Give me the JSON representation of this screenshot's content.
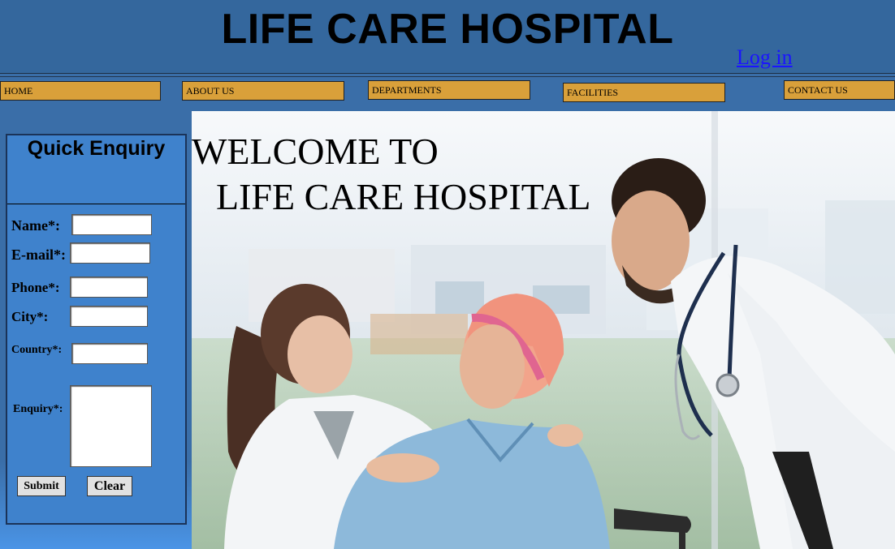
{
  "header": {
    "title": "LIFE CARE HOSPITAL",
    "login_label": "Log in"
  },
  "nav": {
    "items": [
      {
        "label": "HOME"
      },
      {
        "label": "ABOUT US"
      },
      {
        "label": "DEPARTMENTS"
      },
      {
        "label": "FACILITIES"
      },
      {
        "label": "CONTACT US"
      }
    ],
    "button_color": "#d9a03a"
  },
  "hero": {
    "line1": "WELCOME TO",
    "line2": "LIFE CARE HOSPITAL",
    "image_description_icon": "doctors-with-patient-photo"
  },
  "enquiry": {
    "title": "Quick Enquiry",
    "fields": {
      "name": {
        "label": "Name*:",
        "value": ""
      },
      "email": {
        "label": "E-mail*:",
        "value": ""
      },
      "phone": {
        "label": "Phone*:",
        "value": ""
      },
      "city": {
        "label": "City*:",
        "value": ""
      },
      "country": {
        "label": "Country*:",
        "value": ""
      },
      "message": {
        "label": "Enquiry*:",
        "value": ""
      }
    },
    "submit_label": "Submit",
    "clear_label": "Clear"
  },
  "colors": {
    "header_bg": "#34679d",
    "page_bg": "#3a6ea8",
    "form_bg": "#3f82cc",
    "link": "#1a14ff"
  }
}
